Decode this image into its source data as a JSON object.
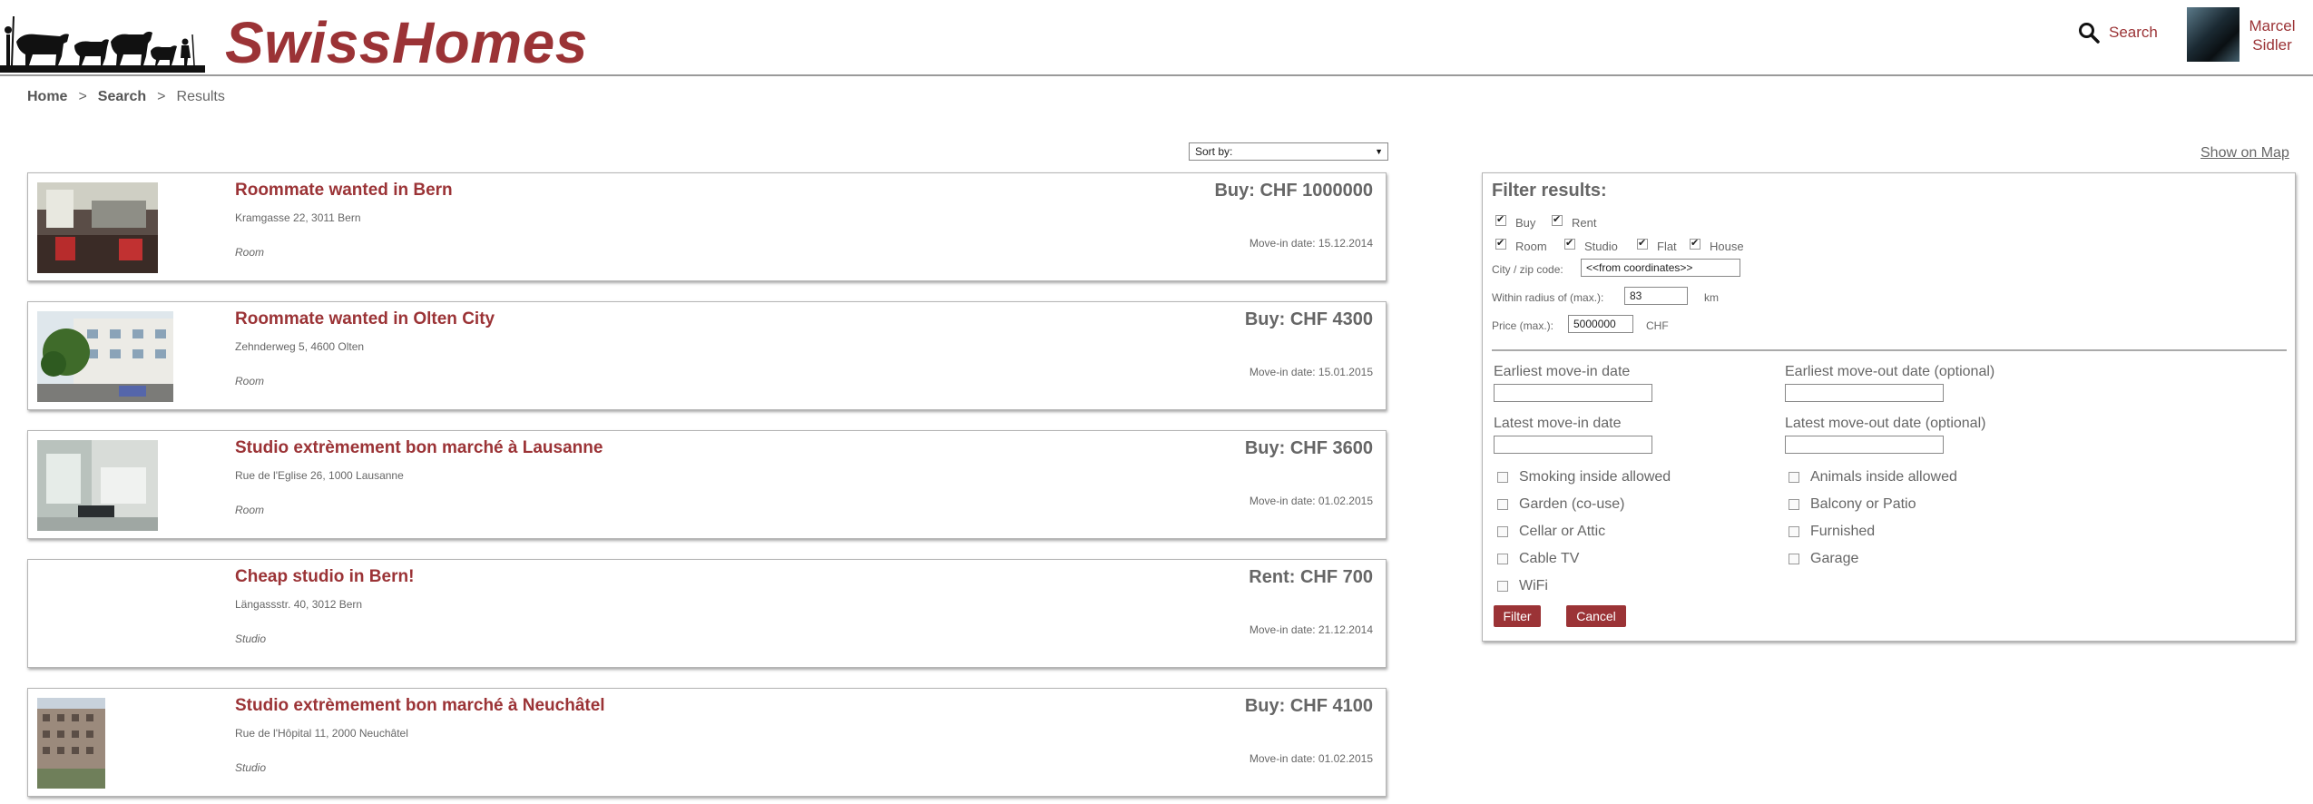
{
  "header": {
    "brand": "SwissHomes",
    "search_label": "Search",
    "user_name_line1": "Marcel",
    "user_name_line2": "Sidler"
  },
  "breadcrumb": {
    "home": "Home",
    "separator": ">",
    "search": "Search",
    "current": "Results"
  },
  "sort": {
    "selected": "Sort by:"
  },
  "results": [
    {
      "title": "Roommate wanted in Bern",
      "address": "Kramgasse 22, 3011 Bern",
      "type": "Room",
      "price": "Buy: CHF 1000000",
      "movein": "Move-in date: 15.12.2014"
    },
    {
      "title": "Roommate wanted in Olten City",
      "address": "Zehnderweg 5, 4600 Olten",
      "type": "Room",
      "price": "Buy: CHF 4300",
      "movein": "Move-in date: 15.01.2015"
    },
    {
      "title": "Studio extrèmement bon marché à Lausanne",
      "address": "Rue de l'Eglise 26, 1000 Lausanne",
      "type": "Room",
      "price": "Buy: CHF 3600",
      "movein": "Move-in date: 01.02.2015"
    },
    {
      "title": "Cheap studio in Bern!",
      "address": "Längassstr. 40, 3012 Bern",
      "type": "Studio",
      "price": "Rent: CHF 700",
      "movein": "Move-in date: 21.12.2014"
    },
    {
      "title": "Studio extrèmement bon marché à Neuchâtel",
      "address": "Rue de l'Hôpital 11, 2000 Neuchâtel",
      "type": "Studio",
      "price": "Buy: CHF 4100",
      "movein": "Move-in date: 01.02.2015"
    }
  ],
  "map_link": "Show on Map",
  "filter": {
    "title": "Filter results:",
    "buy": "Buy",
    "rent": "Rent",
    "room": "Room",
    "studio": "Studio",
    "flat": "Flat",
    "house": "House",
    "city_label": "City / zip code:",
    "city_value": "<<from coordinates>>",
    "radius_label": "Within radius of (max.):",
    "radius_value": "83",
    "radius_unit": "km",
    "price_label": "Price (max.):",
    "price_value": "5000000",
    "price_unit": "CHF",
    "earliest_movein": "Earliest move-in date",
    "earliest_moveout": "Earliest move-out date (optional)",
    "latest_movein": "Latest move-in date",
    "latest_moveout": "Latest move-out date (optional)",
    "options": {
      "smoking": "Smoking inside allowed",
      "animals": "Animals inside allowed",
      "garden": "Garden (co-use)",
      "balcony": "Balcony or Patio",
      "cellar": "Cellar or Attic",
      "furnished": "Furnished",
      "cable": "Cable TV",
      "garage": "Garage",
      "wifi": "WiFi"
    },
    "filter_button": "Filter",
    "cancel_button": "Cancel"
  }
}
